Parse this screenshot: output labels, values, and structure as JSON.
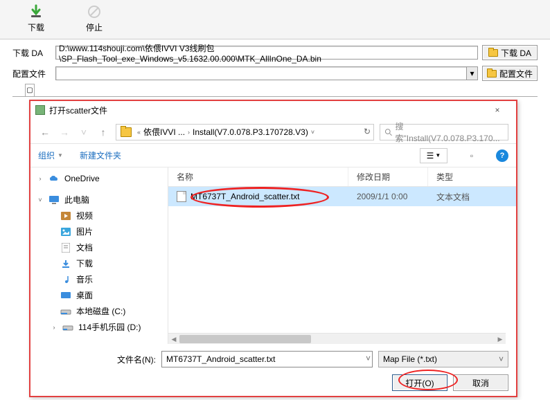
{
  "toolbar": {
    "download_label": "下载",
    "stop_label": "停止"
  },
  "config": {
    "da": {
      "label": "下载 DA",
      "value": "D:\\www.114shouji.com\\依偎IVVI V3线刷包\\SP_Flash_Tool_exe_Windows_v5.1632.00.000\\MTK_AllInOne_DA.bin",
      "button": "下载 DA"
    },
    "cfg": {
      "label": "配置文件",
      "value": "",
      "button": "配置文件"
    }
  },
  "dialog": {
    "title": "打开scatter文件",
    "close_tip": "×",
    "breadcrumb_prefix": "«",
    "breadcrumb": [
      "依偎IVVI ...",
      "Install(V7.0.078.P3.170728.V3)"
    ],
    "search_placeholder": "搜索\"Install(V7.0.078.P3.170...",
    "organize": "组织",
    "new_folder": "新建文件夹",
    "columns": {
      "name": "名称",
      "date": "修改日期",
      "type": "类型"
    },
    "sidebar": {
      "onedrive": "OneDrive",
      "this_pc": "此电脑",
      "videos": "视频",
      "pictures": "图片",
      "documents": "文档",
      "downloads": "下载",
      "music": "音乐",
      "desktop": "桌面",
      "disk_c": "本地磁盘 (C:)",
      "disk_d": "114手机乐园 (D:)"
    },
    "file": {
      "name": "MT6737T_Android_scatter.txt",
      "date": "2009/1/1 0:00",
      "type": "文本文档"
    },
    "footer": {
      "filename_label": "文件名(N):",
      "filename_value": "MT6737T_Android_scatter.txt",
      "filter": "Map File (*.txt)",
      "open": "打开(O)",
      "cancel": "取消"
    }
  }
}
